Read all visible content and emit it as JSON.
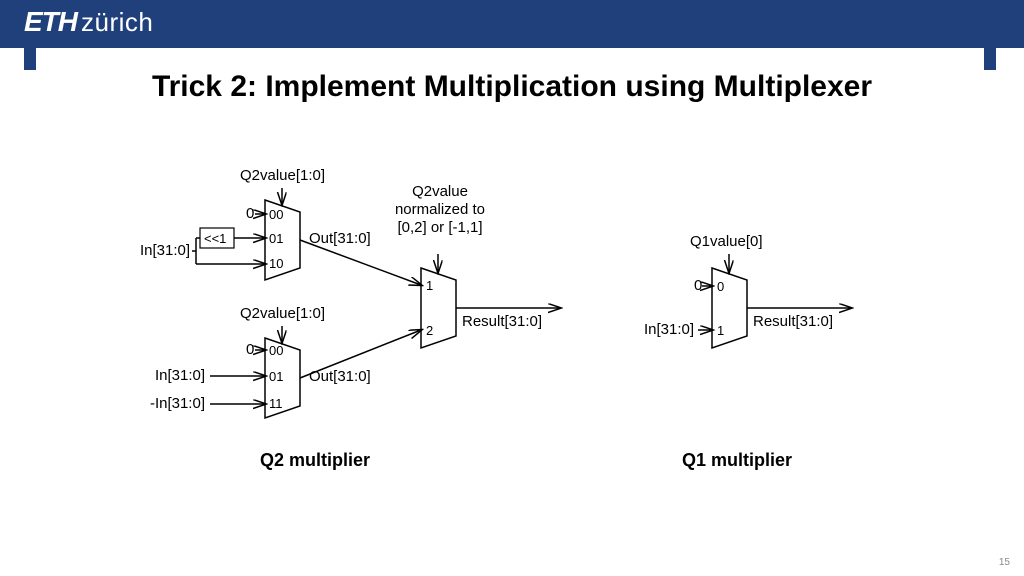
{
  "header": {
    "logo_bold": "ETH",
    "logo_light": "zürich"
  },
  "title": "Trick 2: Implement Multiplication using Multiplexer",
  "q2": {
    "sel_label": "Q2value[1:0]",
    "muxA": {
      "in0_label": "0",
      "in1_label": "<<1",
      "in_bus": "In[31:0]",
      "p0": "00",
      "p1": "01",
      "p2": "10",
      "out": "Out[31:0]"
    },
    "muxB": {
      "in0_label": "0",
      "in1_label": "In[31:0]",
      "in2_label": "-In[31:0]",
      "p0": "00",
      "p1": "01",
      "p2": "11",
      "out": "Out[31:0]"
    },
    "norm_label_l1": "Q2value",
    "norm_label_l2": "normalized to",
    "norm_label_l3": "[0,2] or [-1,1]",
    "muxC": {
      "p0": "1",
      "p1": "2",
      "out": "Result[31:0]"
    },
    "caption": "Q2 multiplier"
  },
  "q1": {
    "sel_label": "Q1value[0]",
    "mux": {
      "in0_label": "0",
      "in1_label": "In[31:0]",
      "p0": "0",
      "p1": "1",
      "out": "Result[31:0]"
    },
    "caption": "Q1 multiplier"
  },
  "page_number": "15"
}
